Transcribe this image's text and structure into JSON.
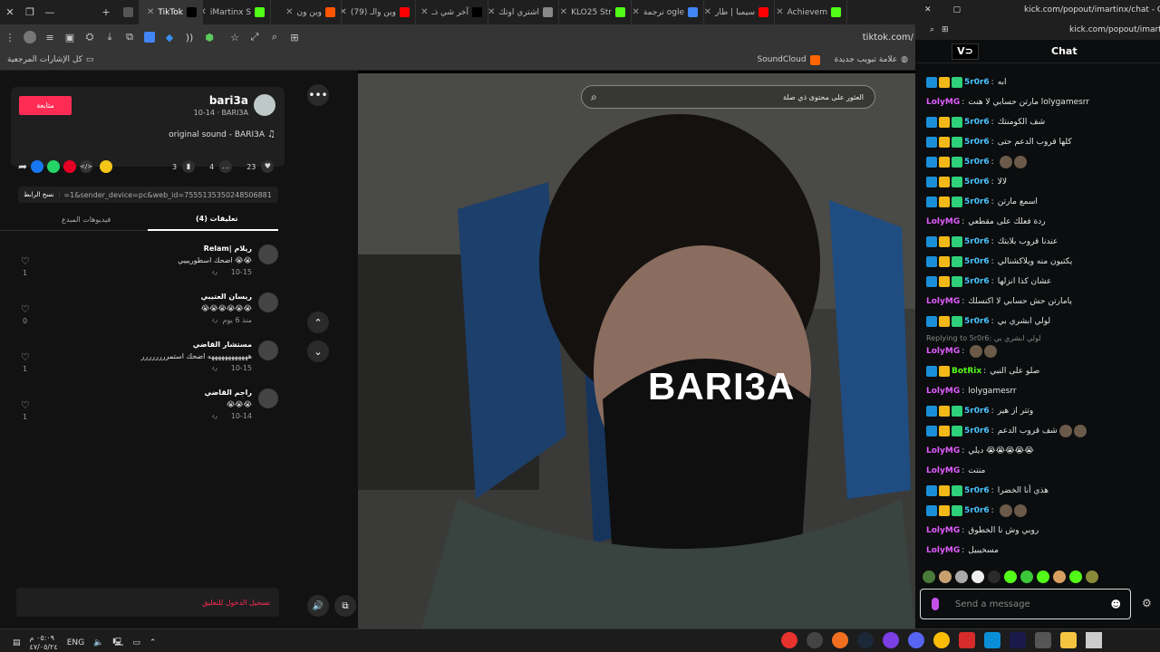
{
  "browser": {
    "tabs": [
      {
        "label": "",
        "active": false
      },
      {
        "label": "TikTok",
        "active": true
      },
      {
        "label": "iMartinx S",
        "active": false
      },
      {
        "label": "وين ون",
        "active": false
      },
      {
        "label": "(79) وين والـ",
        "active": false
      },
      {
        "label": "آخر شي ذـ",
        "active": false
      },
      {
        "label": "اشتري اوتك",
        "active": false
      },
      {
        "label": "KLO25 Str",
        "active": false
      },
      {
        "label": "ترجمة ogle",
        "active": false
      },
      {
        "label": "سيمبا | طار",
        "active": false
      },
      {
        "label": "Achievem",
        "active": false
      }
    ],
    "new_tab": "+",
    "url": "tiktok.com/",
    "bookmarks": [
      "كل الإشارات المرجعية",
      "علامة تبويب جديدة",
      "SoundCloud"
    ]
  },
  "tiktok": {
    "follow_label": "متابعة",
    "username": "bari3a",
    "nickname_date": "10-14 · BARI3A",
    "sound": "original sound - BARI3A",
    "counts": {
      "likes": "23",
      "comments": "4",
      "saves": "3"
    },
    "copy_link_label": "نسخ الرابط",
    "link_value": "=1&sender_device=pc&web_id=7555135350248506881",
    "tabs": {
      "comments": "تعليقات (4)",
      "creator_videos": "فيديوهات المبدع"
    },
    "comments": [
      {
        "name": "Relam| ريلام",
        "text": "اضحك اسطوريييي 😭😭",
        "date": "10-15",
        "reply": "رد",
        "likes": "1"
      },
      {
        "name": "ريسان العتيبي",
        "text": "😭😭😭😭😭😭",
        "date": "منذ 6 يوم",
        "reply": "رد",
        "likes": "0"
      },
      {
        "name": "مستشار القاضي",
        "text": "ههههههههههههه اضحك استمرررررررر",
        "date": "10-15",
        "reply": "رد",
        "likes": "1"
      },
      {
        "name": "راجم القاضي",
        "text": "😭😭😭",
        "date": "10-14",
        "reply": "رد",
        "likes": "1"
      }
    ],
    "login_prompt": "تسجيل الدخول للتعليق",
    "search_placeholder": "العثور على محتوى ذي صلة",
    "overlay_text": "BARI3A"
  },
  "chat_window": {
    "url": "kick.com/popout/imartinx/chat - Goog",
    "url_bar": "kick.com/popout/imartinx",
    "title": "Chat",
    "messages": [
      {
        "user": "5r0r6",
        "text": "ابه",
        "cls": "u-sr",
        "badges": 3
      },
      {
        "user": "LolyMG",
        "text": "مارتن حسابي لا هنت lolygamesrr",
        "cls": "u-loly",
        "badges": 0
      },
      {
        "user": "5r0r6",
        "text": "شف الكومنتك",
        "cls": "u-sr",
        "badges": 3
      },
      {
        "user": "5r0r6",
        "text": "كلها قروب الدعم حتى",
        "cls": "u-sr",
        "badges": 3
      },
      {
        "user": "5r0r6",
        "text": "",
        "cls": "u-sr",
        "badges": 3,
        "emotes": 2
      },
      {
        "user": "5r0r6",
        "text": "لالا",
        "cls": "u-sr",
        "badges": 3
      },
      {
        "user": "5r0r6",
        "text": "اسمع مارتن",
        "cls": "u-sr",
        "badges": 3
      },
      {
        "user": "LolyMG",
        "text": "ردة فعلك على مقطعي",
        "cls": "u-loly",
        "badges": 0
      },
      {
        "user": "5r0r6",
        "text": "عندنا قروب بلابتك",
        "cls": "u-sr",
        "badges": 3
      },
      {
        "user": "5r0r6",
        "text": "يكتبون منه ويلاكشنالي",
        "cls": "u-sr",
        "badges": 3
      },
      {
        "user": "5r0r6",
        "text": "عشان كذا انزلها",
        "cls": "u-sr",
        "badges": 3
      },
      {
        "user": "LolyMG",
        "text": "يامارتن حش حسابي لا اكنسلك",
        "cls": "u-loly",
        "badges": 0
      },
      {
        "user": "5r0r6",
        "text": "لولي ابشري بي",
        "cls": "u-sr",
        "badges": 3
      }
    ],
    "reply_hint": "Replying to 5r0r6: لولي ابشري بي",
    "messages2": [
      {
        "user": "LolyMG",
        "text": "",
        "cls": "u-loly",
        "badges": 0,
        "emotes": 2
      },
      {
        "user": "BotRix",
        "text": "صلو على النبي",
        "cls": "u-bot",
        "badges": 2
      },
      {
        "user": "LolyMG",
        "text": "lolygamesrr",
        "cls": "u-loly",
        "badges": 0
      },
      {
        "user": "5r0r6",
        "text": "وتتر از هير",
        "cls": "u-sr",
        "badges": 3
      },
      {
        "user": "5r0r6",
        "text": "شف قروب الدعم",
        "cls": "u-sr",
        "badges": 3,
        "emotes": 2
      },
      {
        "user": "LolyMG",
        "text": "ديلي 😭😭😭😭😭",
        "cls": "u-loly",
        "badges": 0
      },
      {
        "user": "LolyMG",
        "text": "منتت",
        "cls": "u-loly",
        "badges": 0
      },
      {
        "user": "5r0r6",
        "text": "هذي أنا الخضرا",
        "cls": "u-sr",
        "badges": 3
      },
      {
        "user": "5r0r6",
        "text": "",
        "cls": "u-sr",
        "badges": 3,
        "emotes": 2
      },
      {
        "user": "LolyMG",
        "text": "روبي وش نا الخطوق",
        "cls": "u-loly",
        "badges": 0
      },
      {
        "user": "LolyMG",
        "text": "مسخيبيل",
        "cls": "u-loly",
        "badges": 0
      }
    ],
    "input_placeholder": "Send a message"
  },
  "taskbar": {
    "lang": "ENG",
    "time": "٠٥:٠٩ م",
    "date": "٤٧/٠٥/٢٤"
  },
  "colors": {
    "tiktok_red": "#fe2c55",
    "kick_green": "#53fc18"
  }
}
